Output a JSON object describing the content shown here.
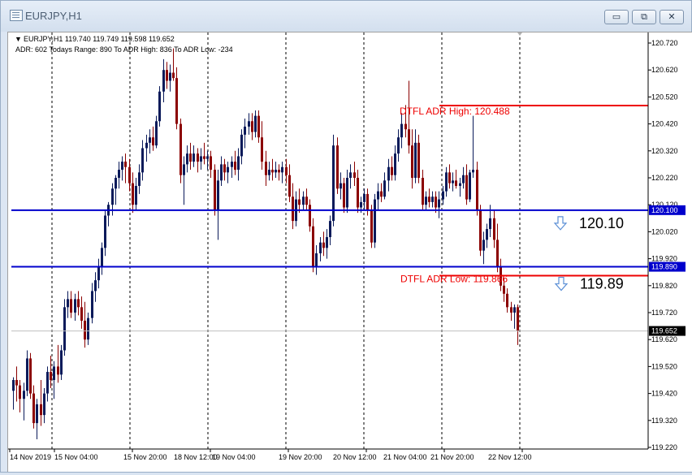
{
  "window": {
    "title": "EURJPY,H1",
    "buttons": {
      "minimize": "▭",
      "restore": "⧉",
      "close": "✕"
    },
    "icon": "chart-window-icon"
  },
  "chart_data": {
    "type": "candlestick",
    "symbol": "EURJPY",
    "timeframe": "H1",
    "info_line": "EURJPY,H1  119.740 119.749 119.598 119.652",
    "adr_line": "ADR: 602   Todays Range: 890   To ADR High: 836   To ADR Low: -234",
    "ylim": [
      119.19,
      120.79
    ],
    "y_ticks": [
      "120.720",
      "120.620",
      "120.520",
      "120.420",
      "120.320",
      "120.220",
      "120.120",
      "120.020",
      "119.920",
      "119.820",
      "119.720",
      "119.620",
      "119.520",
      "119.420",
      "119.320",
      "119.220"
    ],
    "x_ticks": [
      "14 Nov 2019",
      "15 Nov 04:00",
      "15 Nov 20:00",
      "18 Nov 12:00",
      "19 Nov 04:00",
      "19 Nov 20:00",
      "20 Nov 12:00",
      "21 Nov 04:00",
      "21 Nov 20:00",
      "22 Nov 12:00"
    ],
    "current_price": "119.652",
    "levels": [
      {
        "label": "120.100",
        "value": 120.1,
        "color": "#0000cc"
      },
      {
        "label": "119.890",
        "value": 119.89,
        "color": "#0000cc"
      }
    ],
    "adr_high": {
      "label": "DTFL ADR High: 120.488",
      "value": 120.488,
      "color": "#ee0000"
    },
    "adr_low": {
      "label": "DTFL ADR Low: 119.866",
      "value": 119.866,
      "color": "#ee0000"
    },
    "annotations": [
      {
        "text": "120.10",
        "icon": "down-arrow-icon"
      },
      {
        "text": "119.89",
        "icon": "down-arrow-icon"
      }
    ],
    "up_color": "#0a1a5a",
    "down_color": "#8b0000",
    "candles": [
      {
        "o": 119.43,
        "h": 119.48,
        "l": 119.36,
        "c": 119.47
      },
      {
        "o": 119.47,
        "h": 119.52,
        "l": 119.39,
        "c": 119.45
      },
      {
        "o": 119.45,
        "h": 119.47,
        "l": 119.35,
        "c": 119.4
      },
      {
        "o": 119.4,
        "h": 119.46,
        "l": 119.32,
        "c": 119.43
      },
      {
        "o": 119.43,
        "h": 119.58,
        "l": 119.41,
        "c": 119.55
      },
      {
        "o": 119.55,
        "h": 119.57,
        "l": 119.4,
        "c": 119.42
      },
      {
        "o": 119.42,
        "h": 119.45,
        "l": 119.29,
        "c": 119.31
      },
      {
        "o": 119.31,
        "h": 119.4,
        "l": 119.25,
        "c": 119.38
      },
      {
        "o": 119.38,
        "h": 119.47,
        "l": 119.3,
        "c": 119.34
      },
      {
        "o": 119.34,
        "h": 119.44,
        "l": 119.31,
        "c": 119.42
      },
      {
        "o": 119.42,
        "h": 119.52,
        "l": 119.39,
        "c": 119.5
      },
      {
        "o": 119.5,
        "h": 119.56,
        "l": 119.44,
        "c": 119.47
      },
      {
        "o": 119.47,
        "h": 119.54,
        "l": 119.4,
        "c": 119.52
      },
      {
        "o": 119.52,
        "h": 119.6,
        "l": 119.46,
        "c": 119.49
      },
      {
        "o": 119.49,
        "h": 119.6,
        "l": 119.47,
        "c": 119.58
      },
      {
        "o": 119.58,
        "h": 119.77,
        "l": 119.56,
        "c": 119.74
      },
      {
        "o": 119.74,
        "h": 119.8,
        "l": 119.7,
        "c": 119.77
      },
      {
        "o": 119.77,
        "h": 119.8,
        "l": 119.7,
        "c": 119.72
      },
      {
        "o": 119.72,
        "h": 119.79,
        "l": 119.69,
        "c": 119.77
      },
      {
        "o": 119.77,
        "h": 119.8,
        "l": 119.71,
        "c": 119.74
      },
      {
        "o": 119.74,
        "h": 119.78,
        "l": 119.66,
        "c": 119.69
      },
      {
        "o": 119.69,
        "h": 119.76,
        "l": 119.59,
        "c": 119.62
      },
      {
        "o": 119.62,
        "h": 119.72,
        "l": 119.6,
        "c": 119.7
      },
      {
        "o": 119.7,
        "h": 119.83,
        "l": 119.68,
        "c": 119.8
      },
      {
        "o": 119.8,
        "h": 119.87,
        "l": 119.76,
        "c": 119.84
      },
      {
        "o": 119.84,
        "h": 119.92,
        "l": 119.81,
        "c": 119.89
      },
      {
        "o": 119.89,
        "h": 119.98,
        "l": 119.86,
        "c": 119.96
      },
      {
        "o": 119.96,
        "h": 120.1,
        "l": 119.93,
        "c": 120.08
      },
      {
        "o": 120.08,
        "h": 120.13,
        "l": 120.04,
        "c": 120.12
      },
      {
        "o": 120.12,
        "h": 120.2,
        "l": 120.08,
        "c": 120.18
      },
      {
        "o": 120.18,
        "h": 120.23,
        "l": 120.12,
        "c": 120.22
      },
      {
        "o": 120.22,
        "h": 120.28,
        "l": 120.18,
        "c": 120.25
      },
      {
        "o": 120.25,
        "h": 120.3,
        "l": 120.21,
        "c": 120.28
      },
      {
        "o": 120.28,
        "h": 120.31,
        "l": 120.2,
        "c": 120.26
      },
      {
        "o": 120.26,
        "h": 120.29,
        "l": 120.17,
        "c": 120.2
      },
      {
        "o": 120.2,
        "h": 120.24,
        "l": 120.09,
        "c": 120.12
      },
      {
        "o": 120.12,
        "h": 120.22,
        "l": 120.1,
        "c": 120.19
      },
      {
        "o": 120.19,
        "h": 120.27,
        "l": 120.16,
        "c": 120.24
      },
      {
        "o": 120.24,
        "h": 120.36,
        "l": 120.21,
        "c": 120.33
      },
      {
        "o": 120.33,
        "h": 120.38,
        "l": 120.28,
        "c": 120.35
      },
      {
        "o": 120.35,
        "h": 120.4,
        "l": 120.31,
        "c": 120.37
      },
      {
        "o": 120.37,
        "h": 120.41,
        "l": 120.32,
        "c": 120.34
      },
      {
        "o": 120.34,
        "h": 120.45,
        "l": 120.33,
        "c": 120.43
      },
      {
        "o": 120.43,
        "h": 120.56,
        "l": 120.41,
        "c": 120.54
      },
      {
        "o": 120.54,
        "h": 120.66,
        "l": 120.5,
        "c": 120.62
      },
      {
        "o": 120.62,
        "h": 120.65,
        "l": 120.55,
        "c": 120.58
      },
      {
        "o": 120.58,
        "h": 120.64,
        "l": 120.54,
        "c": 120.61
      },
      {
        "o": 120.61,
        "h": 120.7,
        "l": 120.58,
        "c": 120.59
      },
      {
        "o": 120.59,
        "h": 120.63,
        "l": 120.4,
        "c": 120.42
      },
      {
        "o": 120.42,
        "h": 120.44,
        "l": 120.2,
        "c": 120.23
      },
      {
        "o": 120.23,
        "h": 120.3,
        "l": 120.12,
        "c": 120.27
      },
      {
        "o": 120.27,
        "h": 120.34,
        "l": 120.24,
        "c": 120.31
      },
      {
        "o": 120.31,
        "h": 120.35,
        "l": 120.25,
        "c": 120.28
      },
      {
        "o": 120.28,
        "h": 120.34,
        "l": 120.26,
        "c": 120.31
      },
      {
        "o": 120.31,
        "h": 120.33,
        "l": 120.24,
        "c": 120.28
      },
      {
        "o": 120.28,
        "h": 120.33,
        "l": 120.25,
        "c": 120.3
      },
      {
        "o": 120.3,
        "h": 120.35,
        "l": 120.27,
        "c": 120.29
      },
      {
        "o": 120.29,
        "h": 120.32,
        "l": 120.25,
        "c": 120.3
      },
      {
        "o": 120.3,
        "h": 120.32,
        "l": 120.22,
        "c": 120.25
      },
      {
        "o": 120.25,
        "h": 120.27,
        "l": 120.08,
        "c": 120.1
      },
      {
        "o": 120.1,
        "h": 120.25,
        "l": 119.99,
        "c": 120.21
      },
      {
        "o": 120.21,
        "h": 120.3,
        "l": 120.19,
        "c": 120.27
      },
      {
        "o": 120.27,
        "h": 120.29,
        "l": 120.21,
        "c": 120.24
      },
      {
        "o": 120.24,
        "h": 120.28,
        "l": 120.2,
        "c": 120.26
      },
      {
        "o": 120.26,
        "h": 120.3,
        "l": 120.22,
        "c": 120.28
      },
      {
        "o": 120.28,
        "h": 120.32,
        "l": 120.23,
        "c": 120.25
      },
      {
        "o": 120.25,
        "h": 120.33,
        "l": 120.21,
        "c": 120.3
      },
      {
        "o": 120.3,
        "h": 120.4,
        "l": 120.27,
        "c": 120.38
      },
      {
        "o": 120.38,
        "h": 120.44,
        "l": 120.33,
        "c": 120.41
      },
      {
        "o": 120.41,
        "h": 120.46,
        "l": 120.38,
        "c": 120.43
      },
      {
        "o": 120.43,
        "h": 120.46,
        "l": 120.36,
        "c": 120.39
      },
      {
        "o": 120.39,
        "h": 120.47,
        "l": 120.37,
        "c": 120.45
      },
      {
        "o": 120.45,
        "h": 120.47,
        "l": 120.35,
        "c": 120.37
      },
      {
        "o": 120.37,
        "h": 120.43,
        "l": 120.25,
        "c": 120.28
      },
      {
        "o": 120.28,
        "h": 120.32,
        "l": 120.19,
        "c": 120.23
      },
      {
        "o": 120.23,
        "h": 120.28,
        "l": 120.21,
        "c": 120.25
      },
      {
        "o": 120.25,
        "h": 120.29,
        "l": 120.21,
        "c": 120.24
      },
      {
        "o": 120.24,
        "h": 120.28,
        "l": 120.22,
        "c": 120.25
      },
      {
        "o": 120.25,
        "h": 120.27,
        "l": 120.21,
        "c": 120.24
      },
      {
        "o": 120.24,
        "h": 120.28,
        "l": 120.2,
        "c": 120.26
      },
      {
        "o": 120.26,
        "h": 120.29,
        "l": 120.2,
        "c": 120.23
      },
      {
        "o": 120.23,
        "h": 120.27,
        "l": 120.13,
        "c": 120.15
      },
      {
        "o": 120.15,
        "h": 120.2,
        "l": 120.03,
        "c": 120.06
      },
      {
        "o": 120.06,
        "h": 120.17,
        "l": 120.04,
        "c": 120.14
      },
      {
        "o": 120.14,
        "h": 120.18,
        "l": 120.09,
        "c": 120.12
      },
      {
        "o": 120.12,
        "h": 120.17,
        "l": 120.1,
        "c": 120.15
      },
      {
        "o": 120.15,
        "h": 120.18,
        "l": 120.1,
        "c": 120.12
      },
      {
        "o": 120.12,
        "h": 120.14,
        "l": 120.02,
        "c": 120.04
      },
      {
        "o": 120.04,
        "h": 120.07,
        "l": 119.87,
        "c": 119.89
      },
      {
        "o": 119.89,
        "h": 119.97,
        "l": 119.86,
        "c": 119.94
      },
      {
        "o": 119.94,
        "h": 120.0,
        "l": 119.91,
        "c": 119.98
      },
      {
        "o": 119.98,
        "h": 120.02,
        "l": 119.93,
        "c": 119.96
      },
      {
        "o": 119.96,
        "h": 120.03,
        "l": 119.92,
        "c": 120.0
      },
      {
        "o": 120.0,
        "h": 120.08,
        "l": 119.97,
        "c": 120.06
      },
      {
        "o": 120.06,
        "h": 120.38,
        "l": 120.04,
        "c": 120.34
      },
      {
        "o": 120.34,
        "h": 120.37,
        "l": 120.16,
        "c": 120.18
      },
      {
        "o": 120.18,
        "h": 120.24,
        "l": 120.14,
        "c": 120.2
      },
      {
        "o": 120.2,
        "h": 120.22,
        "l": 120.09,
        "c": 120.11
      },
      {
        "o": 120.11,
        "h": 120.25,
        "l": 120.09,
        "c": 120.22
      },
      {
        "o": 120.22,
        "h": 120.27,
        "l": 120.18,
        "c": 120.24
      },
      {
        "o": 120.24,
        "h": 120.28,
        "l": 120.19,
        "c": 120.22
      },
      {
        "o": 120.22,
        "h": 120.25,
        "l": 120.09,
        "c": 120.11
      },
      {
        "o": 120.11,
        "h": 120.15,
        "l": 120.09,
        "c": 120.13
      },
      {
        "o": 120.13,
        "h": 120.18,
        "l": 120.1,
        "c": 120.16
      },
      {
        "o": 120.16,
        "h": 120.18,
        "l": 120.08,
        "c": 120.1
      },
      {
        "o": 120.1,
        "h": 120.12,
        "l": 119.96,
        "c": 119.98
      },
      {
        "o": 119.98,
        "h": 120.16,
        "l": 119.96,
        "c": 120.14
      },
      {
        "o": 120.14,
        "h": 120.2,
        "l": 120.1,
        "c": 120.17
      },
      {
        "o": 120.17,
        "h": 120.2,
        "l": 120.13,
        "c": 120.15
      },
      {
        "o": 120.15,
        "h": 120.24,
        "l": 120.14,
        "c": 120.21
      },
      {
        "o": 120.21,
        "h": 120.29,
        "l": 120.17,
        "c": 120.26
      },
      {
        "o": 120.26,
        "h": 120.3,
        "l": 120.21,
        "c": 120.23
      },
      {
        "o": 120.23,
        "h": 120.34,
        "l": 120.21,
        "c": 120.31
      },
      {
        "o": 120.31,
        "h": 120.4,
        "l": 120.28,
        "c": 120.37
      },
      {
        "o": 120.37,
        "h": 120.46,
        "l": 120.33,
        "c": 120.42
      },
      {
        "o": 120.42,
        "h": 120.49,
        "l": 120.37,
        "c": 120.4
      },
      {
        "o": 120.4,
        "h": 120.58,
        "l": 120.31,
        "c": 120.34
      },
      {
        "o": 120.34,
        "h": 120.4,
        "l": 120.18,
        "c": 120.22
      },
      {
        "o": 120.22,
        "h": 120.4,
        "l": 120.2,
        "c": 120.35
      },
      {
        "o": 120.35,
        "h": 120.38,
        "l": 120.2,
        "c": 120.22
      },
      {
        "o": 120.22,
        "h": 120.25,
        "l": 120.1,
        "c": 120.12
      },
      {
        "o": 120.12,
        "h": 120.17,
        "l": 120.1,
        "c": 120.15
      },
      {
        "o": 120.15,
        "h": 120.18,
        "l": 120.11,
        "c": 120.13
      },
      {
        "o": 120.13,
        "h": 120.17,
        "l": 120.11,
        "c": 120.15
      },
      {
        "o": 120.15,
        "h": 120.17,
        "l": 120.09,
        "c": 120.11
      },
      {
        "o": 120.11,
        "h": 120.17,
        "l": 120.07,
        "c": 120.14
      },
      {
        "o": 120.14,
        "h": 120.19,
        "l": 120.12,
        "c": 120.17
      },
      {
        "o": 120.17,
        "h": 120.26,
        "l": 120.15,
        "c": 120.24
      },
      {
        "o": 120.24,
        "h": 120.27,
        "l": 120.18,
        "c": 120.2
      },
      {
        "o": 120.2,
        "h": 120.24,
        "l": 120.17,
        "c": 120.21
      },
      {
        "o": 120.21,
        "h": 120.25,
        "l": 120.18,
        "c": 120.19
      },
      {
        "o": 120.19,
        "h": 120.22,
        "l": 120.15,
        "c": 120.2
      },
      {
        "o": 120.2,
        "h": 120.26,
        "l": 120.18,
        "c": 120.23
      },
      {
        "o": 120.23,
        "h": 120.27,
        "l": 120.12,
        "c": 120.14
      },
      {
        "o": 120.14,
        "h": 120.25,
        "l": 120.13,
        "c": 120.24
      },
      {
        "o": 120.24,
        "h": 120.45,
        "l": 120.22,
        "c": 120.25
      },
      {
        "o": 120.25,
        "h": 120.28,
        "l": 120.08,
        "c": 120.1
      },
      {
        "o": 120.1,
        "h": 120.12,
        "l": 119.93,
        "c": 119.95
      },
      {
        "o": 119.95,
        "h": 120.02,
        "l": 119.9,
        "c": 119.99
      },
      {
        "o": 119.99,
        "h": 120.05,
        "l": 119.96,
        "c": 120.03
      },
      {
        "o": 120.03,
        "h": 120.12,
        "l": 120.0,
        "c": 120.07
      },
      {
        "o": 120.07,
        "h": 120.1,
        "l": 119.96,
        "c": 119.99
      },
      {
        "o": 119.99,
        "h": 120.05,
        "l": 119.87,
        "c": 119.89
      },
      {
        "o": 119.89,
        "h": 119.92,
        "l": 119.8,
        "c": 119.82
      },
      {
        "o": 119.82,
        "h": 119.85,
        "l": 119.76,
        "c": 119.79
      },
      {
        "o": 119.79,
        "h": 119.81,
        "l": 119.72,
        "c": 119.74
      },
      {
        "o": 119.74,
        "h": 119.76,
        "l": 119.69,
        "c": 119.72
      },
      {
        "o": 119.72,
        "h": 119.75,
        "l": 119.66,
        "c": 119.74
      },
      {
        "o": 119.74,
        "h": 119.75,
        "l": 119.6,
        "c": 119.652
      }
    ]
  }
}
